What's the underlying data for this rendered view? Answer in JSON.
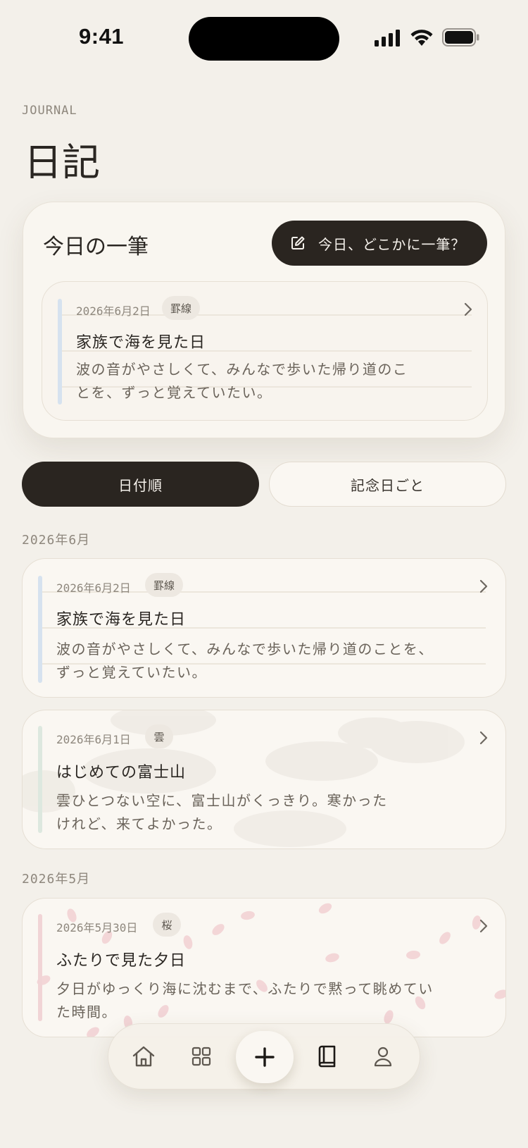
{
  "status_bar": {
    "time": "9:41"
  },
  "header": {
    "eyebrow": "JOURNAL",
    "title": "日記"
  },
  "today_card": {
    "title": "今日の一筆",
    "cta_label": "今日、どこかに一筆？",
    "entry": {
      "date": "2026年6月2日",
      "badge": "罫線",
      "title": "家族で海を見た日",
      "body_line1": "波の音がやさしくて、みんなで歩いた帰り道のこ",
      "body_line2": "とを、ずっと覚えていたい。",
      "accent_color": "#d6e2ef"
    }
  },
  "sort_toggle": {
    "by_date": "日付順",
    "by_anniversary": "記念日ごと"
  },
  "sections": [
    {
      "label": "2026年6月",
      "entries": [
        {
          "date": "2026年6月2日",
          "badge": "罫線",
          "title": "家族で海を見た日",
          "body_line1": "波の音がやさしくて、みんなで歩いた帰り道のことを、",
          "body_line2": "ずっと覚えていたい。",
          "accent_color": "#d6e2ef"
        },
        {
          "date": "2026年6月1日",
          "badge": "雲",
          "title": "はじめての富士山",
          "body_line1": "雲ひとつない空に、富士山がくっきり。寒かった",
          "body_line2": "けれど、来てよかった。",
          "accent_color": "#dde8df"
        }
      ]
    },
    {
      "label": "2026年5月",
      "entries": [
        {
          "date": "2026年5月30日",
          "badge": "桜",
          "title": "ふたりで見た夕日",
          "body_line1": "夕日がゆっくり海に沈むまで、ふたりで黙って眺めてい",
          "body_line2": "た時間。",
          "accent_color": "#f1d4d6"
        }
      ]
    }
  ],
  "tab_bar": {
    "icons": [
      "home-icon",
      "grid-icon",
      "plus-icon",
      "book-icon",
      "person-icon"
    ],
    "active": "book-icon"
  },
  "colors": {
    "background": "#f3f0ea",
    "ink": "#2a2520",
    "card": "#faf7f2",
    "muted": "#8e877d"
  }
}
